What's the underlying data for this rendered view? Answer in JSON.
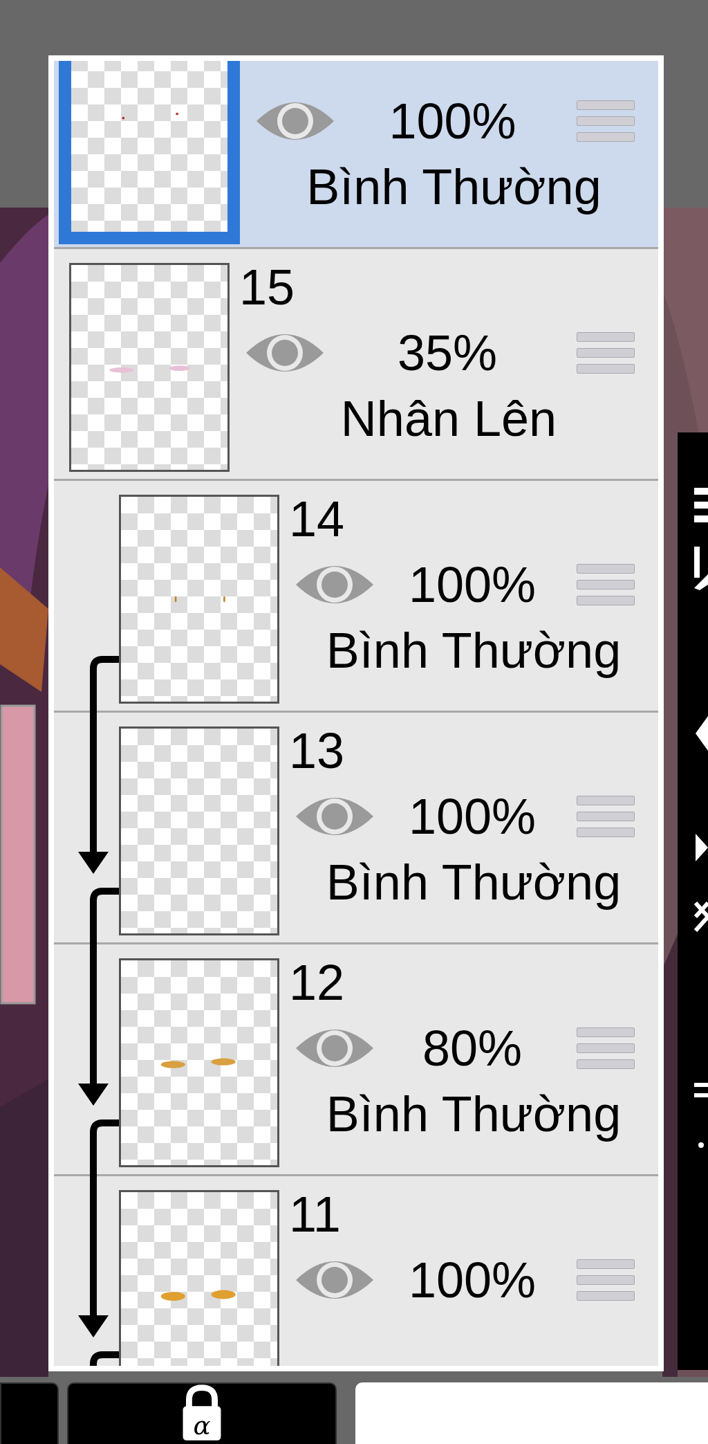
{
  "layers": [
    {
      "opacity": "100%",
      "blend_mode": "Bình Thường",
      "selected": true,
      "visible": true,
      "clipping": false
    },
    {
      "number": "15",
      "opacity": "35%",
      "blend_mode": "Nhân Lên",
      "selected": false,
      "visible": true,
      "clipping": false
    },
    {
      "number": "14",
      "opacity": "100%",
      "blend_mode": "Bình Thường",
      "selected": false,
      "visible": true,
      "clipping": true
    },
    {
      "number": "13",
      "opacity": "100%",
      "blend_mode": "Bình Thường",
      "selected": false,
      "visible": true,
      "clipping": true
    },
    {
      "number": "12",
      "opacity": "80%",
      "blend_mode": "Bình Thường",
      "selected": false,
      "visible": true,
      "clipping": true
    },
    {
      "number": "11",
      "opacity": "100%",
      "selected": false,
      "visible": true,
      "clipping": true
    }
  ],
  "bottom_bar": {
    "alpha_lock": {
      "symbol": "α"
    }
  }
}
